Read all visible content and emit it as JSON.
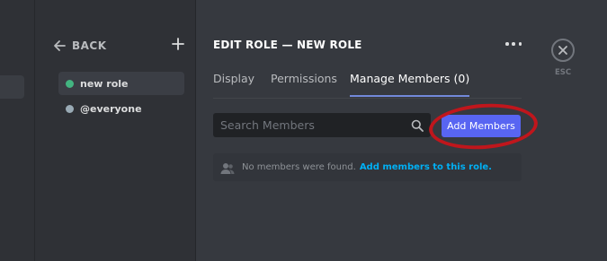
{
  "sidebar": {
    "back_label": "BACK",
    "roles": [
      {
        "name": "new role",
        "color": "#43b581",
        "active": true
      },
      {
        "name": "@everyone",
        "color": "#99aab5",
        "active": false
      }
    ]
  },
  "header": {
    "title": "EDIT ROLE — NEW ROLE"
  },
  "tabs": [
    {
      "label": "Display"
    },
    {
      "label": "Permissions"
    },
    {
      "label": "Manage Members (0)",
      "active": true
    }
  ],
  "search": {
    "placeholder": "Search Members",
    "icon": "search-icon"
  },
  "add_members_button": "Add Members",
  "empty_state": {
    "message": "No members were found.",
    "link": "Add members to this role."
  },
  "close": {
    "esc_label": "ESC"
  },
  "colors": {
    "accent": "#5865f2",
    "link": "#00b0f4",
    "annotation": "#c0161c"
  }
}
